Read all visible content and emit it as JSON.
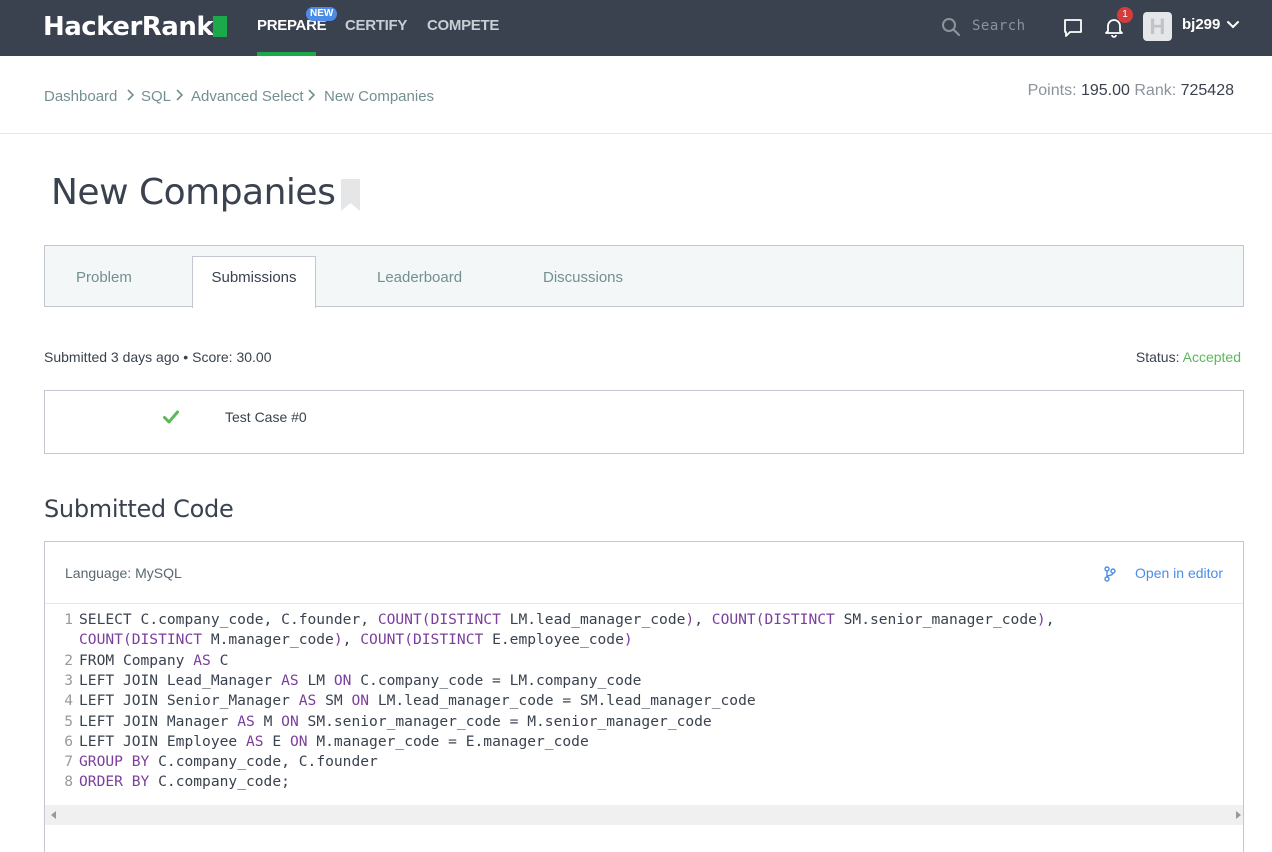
{
  "topnav": {
    "logo": "HackerRank",
    "prepare": "PREPARE",
    "new_badge": "NEW",
    "certify": "CERTIFY",
    "compete": "COMPETE",
    "search_placeholder": "Search",
    "notification_count": "1",
    "avatar_letter": "H",
    "username": "bj299"
  },
  "breadcrumb": [
    "Dashboard",
    "SQL",
    "Advanced Select",
    "New Companies"
  ],
  "stats": {
    "points_label": "Points:",
    "points_value": "195.00",
    "rank_label": "Rank:",
    "rank_value": "725428"
  },
  "page_title": "New Companies",
  "tabs": [
    "Problem",
    "Submissions",
    "Leaderboard",
    "Discussions"
  ],
  "submission": {
    "info": "Submitted 3 days ago • Score: 30.00",
    "status_label": "Status:",
    "status_value": "Accepted",
    "test_case": "Test Case #0"
  },
  "code_section": {
    "title": "Submitted Code",
    "language": "Language: MySQL",
    "open_in_editor": "Open in editor",
    "line_numbers": [
      "1",
      "",
      "2",
      "3",
      "4",
      "5",
      "6",
      "7",
      "8"
    ],
    "lines": [
      "SELECT C.company_code, C.founder, COUNT(DISTINCT LM.lead_manager_code), COUNT(DISTINCT SM.senior_manager_code),",
      "COUNT(DISTINCT M.manager_code), COUNT(DISTINCT E.employee_code)",
      "FROM Company AS C",
      "LEFT JOIN Lead_Manager AS LM ON C.company_code = LM.company_code",
      "LEFT JOIN Senior_Manager AS SM ON LM.lead_manager_code = SM.lead_manager_code",
      "LEFT JOIN Manager AS M ON SM.senior_manager_code = M.senior_manager_code",
      "LEFT JOIN Employee AS E ON M.manager_code = E.manager_code",
      "GROUP BY C.company_code, C.founder",
      "ORDER BY C.company_code;"
    ]
  },
  "colors": {
    "nav_bg": "#39424e",
    "accent_green": "#1ba94c",
    "accepted": "#5cb85c",
    "link_blue": "#4d8ce6",
    "keyword": "#7a3e9d"
  }
}
